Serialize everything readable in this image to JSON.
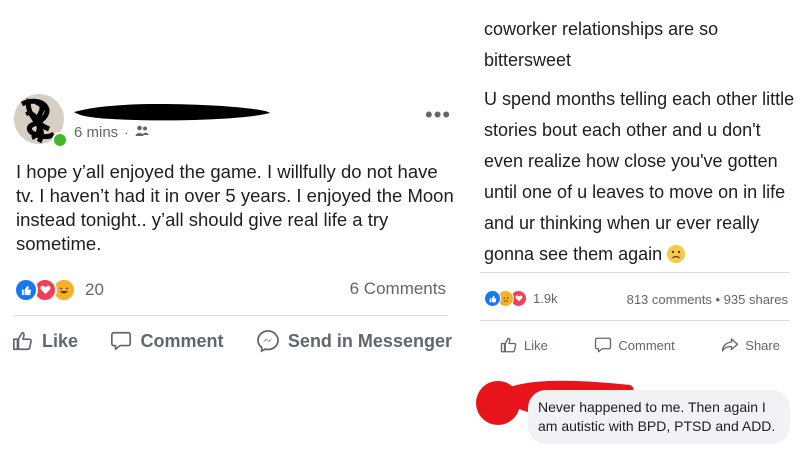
{
  "left_post": {
    "timestamp": "6 mins",
    "separator": "·",
    "audience_icon": "friends-icon",
    "more_icon": "more-options-icon",
    "text": "I hope y’all enjoyed the game. I willfully do not have tv. I haven’t had it in over 5 years. I enjoyed the Moon instead tonight.. y’all should give real life a try sometime.",
    "reaction_count": "20",
    "comments_count": "6 Comments",
    "actions": {
      "like": "Like",
      "comment": "Comment",
      "send": "Send in Messenger"
    }
  },
  "right_post": {
    "text_line1": "coworker relationships are so bittersweet",
    "text_body": "U spend months telling each other little stories bout each other and u don't even realize how close you've gotten until one of u leaves to move on in life and ur thinking when ur ever really gonna see them again",
    "reaction_count": "1.9k",
    "comments": "813 comments",
    "stats_separator": "•",
    "shares": "935 shares",
    "actions": {
      "like": "Like",
      "comment": "Comment",
      "share": "Share"
    },
    "reply_text": "Never happened to me. Then again I am autistic with BPD, PTSD and ADD."
  },
  "colors": {
    "like_blue": "#1877f2",
    "love_red": "#f33e58",
    "haha_yellow": "#f7b125",
    "redaction_black": "#000000",
    "redaction_red": "#e8141b"
  }
}
